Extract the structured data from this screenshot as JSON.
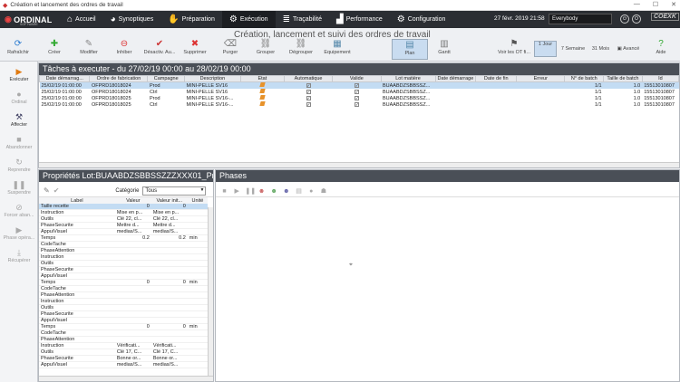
{
  "window": {
    "title": "Création et lancement des ordres de travail",
    "min": "—",
    "max": "☐",
    "close": "✕"
  },
  "nav": {
    "logo": "ORDINAL",
    "logo_sub": "SOFTWARE",
    "items": [
      {
        "label": "Accueil",
        "icon": "⌂"
      },
      {
        "label": "Synoptiques",
        "icon": "◕"
      },
      {
        "label": "Préparation",
        "icon": "✋"
      },
      {
        "label": "Exécution",
        "icon": "⚙"
      },
      {
        "label": "Traçabilité",
        "icon": "≣"
      },
      {
        "label": "Performance",
        "icon": "▟"
      },
      {
        "label": "Configuration",
        "icon": "⚙"
      }
    ],
    "datetime": "27 févr. 2019 21:58",
    "user": "Everybody",
    "brand": "COEXK"
  },
  "page_subtitle": "Création, lancement et suivi des ordres de travail",
  "toolbar": [
    {
      "label": "Rafraîchir",
      "icon": "⟳"
    },
    {
      "label": "Créer",
      "icon": "✚"
    },
    {
      "label": "Modifier",
      "icon": "✎"
    },
    {
      "label": "Inhiber",
      "icon": "⊖"
    },
    {
      "label": "Désactiv. Au...",
      "icon": "✔"
    },
    {
      "label": "Supprimer",
      "icon": "✖"
    },
    {
      "label": "Purger",
      "icon": "⌫"
    },
    {
      "label": "Grouper",
      "icon": "⛓"
    },
    {
      "label": "Dégrouper",
      "icon": "⛓"
    },
    {
      "label": "Equipement",
      "icon": "▦"
    },
    {
      "label": "Plan",
      "icon": "▤"
    },
    {
      "label": "Gantt",
      "icon": "▥"
    }
  ],
  "toolbar_right": [
    {
      "label": "Voir les OT fi...",
      "icon": "⚑"
    },
    {
      "label": "Jour",
      "icon": "1"
    },
    {
      "label": "Semaine",
      "icon": "7"
    },
    {
      "label": "Mois",
      "icon": "31"
    },
    {
      "label": "Avancé",
      "icon": "▣"
    },
    {
      "label": "Aide",
      "icon": "?"
    }
  ],
  "sidebar": [
    {
      "label": "Exécuter",
      "icon": "▶"
    },
    {
      "label": "Ordinal",
      "icon": "●"
    },
    {
      "label": "Affecter",
      "icon": "⚒"
    },
    {
      "label": "Abandonner",
      "icon": "■"
    },
    {
      "label": "Reprendre",
      "icon": "↻"
    },
    {
      "label": "Suspendre",
      "icon": "❚❚"
    },
    {
      "label": "Forcer aban...",
      "icon": "⊘"
    },
    {
      "label": "Phase opéra...",
      "icon": "▶"
    },
    {
      "label": "Récupérer",
      "icon": "⤓"
    }
  ],
  "tasks": {
    "title": "Tâches à executer -  du 27/02/19 00:00 au 28/02/19 00:00",
    "columns": [
      "Date démarrag...",
      "Ordre de fabrication",
      "Campagne",
      "Description",
      "Etat",
      "Automatique",
      "Valide",
      "Lot matière",
      "Date démarrage",
      "Date de fin",
      "Erreur",
      "N° de batch",
      "Taille de batch",
      "Id"
    ],
    "rows": [
      [
        "25/02/19 01:00:00",
        "OFPRD18018024",
        "Prod",
        "MINI-PELLE SV16",
        "",
        "✓",
        "✓",
        "BUAABDZSBBSSZ...",
        "",
        "",
        "",
        "1/1",
        "1.0",
        "15513010807"
      ],
      [
        "25/02/19 01:00:00",
        "OFPRD18018024",
        "Ctrl",
        "MINI-PELLE SV16",
        "",
        "✓",
        "✓",
        "BUAABDZSBBSSZ...",
        "",
        "",
        "",
        "1/1",
        "1.0",
        "15513010807"
      ],
      [
        "25/02/19 01:00:00",
        "OFPRD18018025",
        "Prod",
        "MINI-PELLE SV16-...",
        "",
        "✓",
        "✓",
        "BUAABDZSBBSSZ...",
        "",
        "",
        "",
        "1/1",
        "1.0",
        "15513010807"
      ],
      [
        "25/02/19 01:00:00",
        "OFPRD18018025",
        "Ctrl",
        "MINI-PELLE SV16-...",
        "",
        "✓",
        "✓",
        "BUAABDZSBBSSZ...",
        "",
        "",
        "",
        "1/1",
        "1.0",
        "15513010807"
      ]
    ]
  },
  "props": {
    "title": "Propriétés Lot:BUAABDZSBBSSZZZXXX01_Pro",
    "cat_label": "Catégorie",
    "cat_value": "Tous",
    "columns": [
      "Label",
      "Valeur",
      "Valeur init...",
      "Unité"
    ],
    "rows": [
      [
        "Taille recette",
        "0",
        "0",
        ""
      ],
      [
        "Instruction",
        "Mise en p...",
        "Mise en p...",
        ""
      ],
      [
        "Outils",
        "Clé 22, cl...",
        "Clé 22, cl...",
        ""
      ],
      [
        "PhaseSecurite",
        "Mettre d...",
        "Mettre d...",
        ""
      ],
      [
        "AppuiVisuel",
        "medias/S...",
        "medias/S...",
        ""
      ],
      [
        "Temps",
        "0.2",
        "0.2",
        "min"
      ],
      [
        "CodeTache",
        "",
        "",
        ""
      ],
      [
        "PhaseAttention",
        "",
        "",
        ""
      ],
      [
        "Instruction",
        "",
        "",
        ""
      ],
      [
        "Outils",
        "",
        "",
        ""
      ],
      [
        "PhaseSecurite",
        "",
        "",
        ""
      ],
      [
        "AppuiVisuel",
        "",
        "",
        ""
      ],
      [
        "Temps",
        "0",
        "0",
        "min"
      ],
      [
        "CodeTache",
        "",
        "",
        ""
      ],
      [
        "PhaseAttention",
        "",
        "",
        ""
      ],
      [
        "Instruction",
        "",
        "",
        ""
      ],
      [
        "Outils",
        "",
        "",
        ""
      ],
      [
        "PhaseSecurite",
        "",
        "",
        ""
      ],
      [
        "AppuiVisuel",
        "",
        "",
        ""
      ],
      [
        "Temps",
        "0",
        "0",
        "min"
      ],
      [
        "CodeTache",
        "",
        "",
        ""
      ],
      [
        "PhaseAttention",
        "",
        "",
        ""
      ],
      [
        "Instruction",
        "Vérificati...",
        "Vérificati...",
        ""
      ],
      [
        "Outils",
        "Clé 17, C...",
        "Clé 17, C...",
        ""
      ],
      [
        "PhaseSecurite",
        "Bonne or...",
        "Bonne or...",
        ""
      ],
      [
        "AppuiVisuel",
        "medias/S...",
        "medias/S...",
        ""
      ]
    ]
  },
  "phases": {
    "title": "Phases"
  }
}
